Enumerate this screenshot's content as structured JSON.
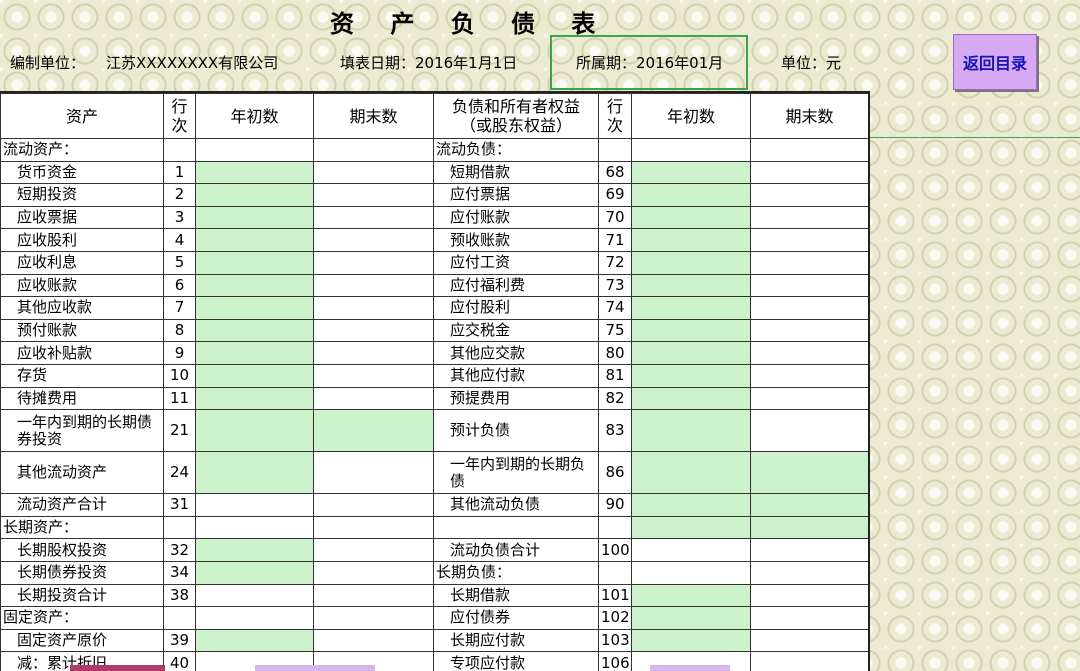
{
  "title": "资 产 负 债 表",
  "info": {
    "unit_label": "编制单位：",
    "company": "江苏XXXXXXXX有限公司",
    "fill_date": "填表日期：2016年1月1日",
    "period": "所属期：2016年01月",
    "currency": "单位：元"
  },
  "back_button": "返回目录",
  "headers": {
    "asset": "资产",
    "line_no": "行\n次",
    "begin": "年初数",
    "end": "期末数",
    "liability": "负债和所有者权益\n（或股东权益）",
    "line_no2": "行\n次",
    "begin2": "年初数",
    "end2": "期末数"
  },
  "rows": [
    {
      "a": "流动资产：",
      "an": "",
      "l": "流动负债：",
      "ln": "",
      "ai": false,
      "li": false,
      "ag": false,
      "lg": false,
      "le": false
    },
    {
      "a": "货币资金",
      "an": "1",
      "l": "短期借款",
      "ln": "68",
      "ai": true,
      "li": true,
      "ag": true,
      "lg": true,
      "le": false
    },
    {
      "a": "短期投资",
      "an": "2",
      "l": "应付票据",
      "ln": "69",
      "ai": true,
      "li": true,
      "ag": true,
      "lg": true,
      "le": false
    },
    {
      "a": "应收票据",
      "an": "3",
      "l": "应付账款",
      "ln": "70",
      "ai": true,
      "li": true,
      "ag": true,
      "lg": true,
      "le": false
    },
    {
      "a": "应收股利",
      "an": "4",
      "l": "预收账款",
      "ln": "71",
      "ai": true,
      "li": true,
      "ag": true,
      "lg": true,
      "le": false
    },
    {
      "a": "应收利息",
      "an": "5",
      "l": "应付工资",
      "ln": "72",
      "ai": true,
      "li": true,
      "ag": true,
      "lg": true,
      "le": false
    },
    {
      "a": "应收账款",
      "an": "6",
      "l": "应付福利费",
      "ln": "73",
      "ai": true,
      "li": true,
      "ag": true,
      "lg": true,
      "le": false
    },
    {
      "a": "其他应收款",
      "an": "7",
      "l": "应付股利",
      "ln": "74",
      "ai": true,
      "li": true,
      "ag": true,
      "lg": true,
      "le": false
    },
    {
      "a": "预付账款",
      "an": "8",
      "l": "应交税金",
      "ln": "75",
      "ai": true,
      "li": true,
      "ag": true,
      "lg": true,
      "le": false
    },
    {
      "a": "应收补贴款",
      "an": "9",
      "l": "其他应交款",
      "ln": "80",
      "ai": true,
      "li": true,
      "ag": true,
      "lg": true,
      "le": false
    },
    {
      "a": "存货",
      "an": "10",
      "l": "其他应付款",
      "ln": "81",
      "ai": true,
      "li": true,
      "ag": true,
      "lg": true,
      "le": false
    },
    {
      "a": "待摊费用",
      "an": "11",
      "l": "预提费用",
      "ln": "82",
      "ai": true,
      "li": true,
      "ag": true,
      "lg": true,
      "le": false
    },
    {
      "a": "一年内到期的长期债券投资",
      "an": "21",
      "l": "预计负债",
      "ln": "83",
      "ai": true,
      "li": true,
      "ag": true,
      "lg": true,
      "le": false,
      "tall": true,
      "ae": true
    },
    {
      "a": "其他流动资产",
      "an": "24",
      "l": "一年内到期的长期负债",
      "ln": "86",
      "ai": true,
      "li": true,
      "ag": true,
      "lg": true,
      "le": true,
      "tall": true
    },
    {
      "a": "流动资产合计",
      "an": "31",
      "l": "其他流动负债",
      "ln": "90",
      "ai": true,
      "li": true,
      "ag": false,
      "lg": true,
      "le": true
    },
    {
      "a": "长期资产：",
      "an": "",
      "l": "",
      "ln": "",
      "ai": false,
      "li": false,
      "ag": false,
      "lg": true,
      "le": true
    },
    {
      "a": "长期股权投资",
      "an": "32",
      "l": "流动负债合计",
      "ln": "100",
      "ai": true,
      "li": true,
      "ag": true,
      "lg": false,
      "le": false
    },
    {
      "a": "长期债券投资",
      "an": "34",
      "l": "长期负债：",
      "ln": "",
      "ai": true,
      "li": false,
      "ag": true,
      "lg": false,
      "le": false
    },
    {
      "a": "长期投资合计",
      "an": "38",
      "l": "长期借款",
      "ln": "101",
      "ai": true,
      "li": true,
      "ag": false,
      "lg": true,
      "le": false
    },
    {
      "a": "固定资产：",
      "an": "",
      "l": "应付债券",
      "ln": "102",
      "ai": false,
      "li": true,
      "ag": false,
      "lg": true,
      "le": false
    },
    {
      "a": "固定资产原价",
      "an": "39",
      "l": "长期应付款",
      "ln": "103",
      "ai": true,
      "li": true,
      "ag": true,
      "lg": true,
      "le": false
    },
    {
      "a": "减：累计折旧",
      "an": "40",
      "l": "专项应付款",
      "ln": "106",
      "ai": true,
      "li": true,
      "ag": false,
      "lg": false,
      "le": false
    }
  ]
}
